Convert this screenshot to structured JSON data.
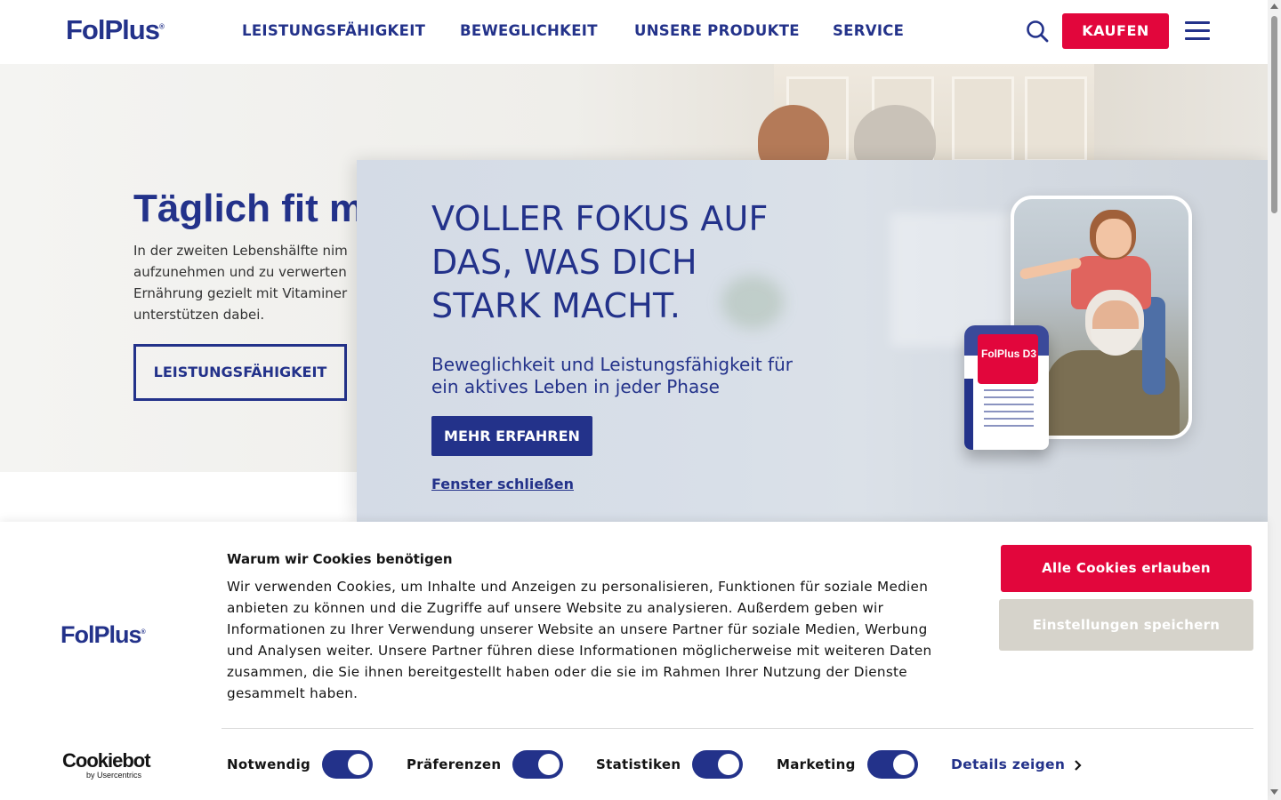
{
  "header": {
    "logo": "FolPlus",
    "logo_mark": "®",
    "nav": [
      "LEISTUNGSFÄHIGKEIT",
      "BEWEGLICHKEIT",
      "UNSERE PRODUKTE",
      "SERVICE"
    ],
    "search_icon": "search-icon",
    "buy_label": "KAUFEN",
    "menu_icon": "hamburger-menu-icon"
  },
  "hero": {
    "title": "Täglich fit m",
    "text_lines": [
      "In der zweiten Lebenshälfte nim",
      "aufzunehmen und zu verwerten",
      "Ernährung gezielt mit Vitaminer",
      "unterstützen dabei."
    ],
    "button_label": "LEISTUNGSFÄHIGKEIT"
  },
  "modal": {
    "title": "VOLLER FOKUS AUF DAS, WAS DICH STARK MACHT.",
    "subtitle": "Beweglichkeit und Leistungsfähigkeit für ein aktives Leben in jeder Phase",
    "button_label": "MEHR ERFAHREN",
    "close_label": "Fenster schließen",
    "product_label": "FolPlus D3"
  },
  "cookie": {
    "logo": "FolPlus",
    "logo_mark": "®",
    "title": "Warum wir Cookies benötigen",
    "text": "Wir verwenden Cookies, um Inhalte und Anzeigen zu personalisieren, Funktionen für soziale Medien anbieten zu können und die Zugriffe auf unsere Website zu analysieren. Außerdem geben wir Informationen zu Ihrer Verwendung unserer Website an unsere Partner für soziale Medien, Werbung und Analysen weiter. Unsere Partner führen diese Informationen möglicherweise mit weiteren Daten zusammen, die Sie ihnen bereitgestellt haben oder die sie im Rahmen Ihrer Nutzung der Dienste gesammelt haben.",
    "allow_all": "Alle Cookies erlauben",
    "save_settings": "Einstellungen speichern",
    "toggles": [
      {
        "label": "Notwendig",
        "on": true
      },
      {
        "label": "Präferenzen",
        "on": true
      },
      {
        "label": "Statistiken",
        "on": true
      },
      {
        "label": "Marketing",
        "on": true
      }
    ],
    "details": "Details zeigen",
    "brand": "Cookiebot",
    "brand_sub": "by Usercentrics"
  },
  "colors": {
    "brand_blue": "#23328a",
    "accent_red": "#e2063c",
    "muted_button": "#d6d3cb"
  }
}
